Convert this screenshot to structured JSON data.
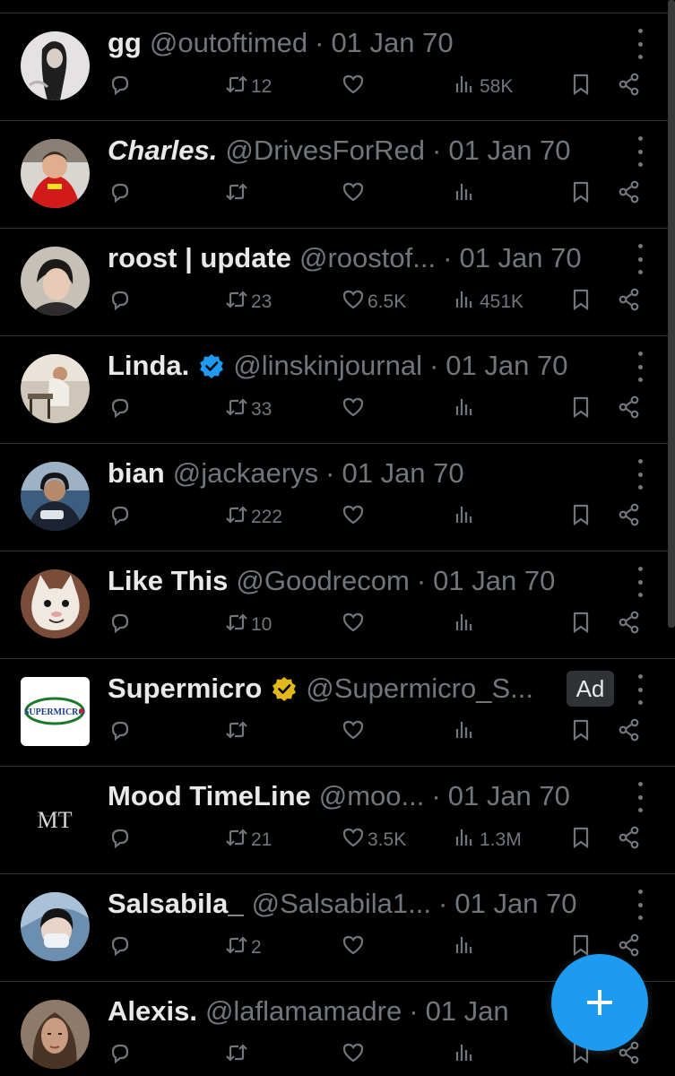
{
  "tweets": [
    {
      "name": "gg",
      "handle": "@outoftimed",
      "date": "01 Jan 70",
      "retweets": "12",
      "likes": "",
      "views": "58K",
      "verified": false,
      "ad": false,
      "italic": false
    },
    {
      "name": "Charles.",
      "handle": "@DrivesForRed",
      "date": "01 Jan 70",
      "retweets": "",
      "likes": "",
      "views": "",
      "verified": false,
      "ad": false,
      "italic": true
    },
    {
      "name": "roost | update",
      "handle": "@roostof...",
      "date": "01 Jan 70",
      "retweets": "23",
      "likes": "6.5K",
      "views": "451K",
      "verified": false,
      "ad": false,
      "italic": false
    },
    {
      "name": "Linda.",
      "handle": "@linskinjournal",
      "date": "01 Jan 70",
      "retweets": "33",
      "likes": "",
      "views": "",
      "verified": "blue",
      "ad": false,
      "italic": false
    },
    {
      "name": "bian",
      "handle": "@jackaerys",
      "date": "01 Jan 70",
      "retweets": "222",
      "likes": "",
      "views": "",
      "verified": false,
      "ad": false,
      "italic": false
    },
    {
      "name": "Like This",
      "handle": "@Goodrecom",
      "date": "01 Jan 70",
      "retweets": "10",
      "likes": "",
      "views": "",
      "verified": false,
      "ad": false,
      "italic": false
    },
    {
      "name": "Supermicro",
      "handle": "@Supermicro_S...",
      "date": "",
      "retweets": "",
      "likes": "",
      "views": "",
      "verified": "gold",
      "ad": true,
      "italic": false
    },
    {
      "name": "Mood TimeLine",
      "handle": "@moo...",
      "date": "01 Jan 70",
      "retweets": "21",
      "likes": "3.5K",
      "views": "1.3M",
      "verified": false,
      "ad": false,
      "italic": false
    },
    {
      "name": "Salsabila_",
      "handle": "@Salsabila1...",
      "date": "01 Jan 70",
      "retweets": "2",
      "likes": "",
      "views": "",
      "verified": false,
      "ad": false,
      "italic": false
    },
    {
      "name": "Alexis.",
      "handle": "@laflamamadre",
      "date": "01 Jan",
      "retweets": "",
      "likes": "",
      "views": "",
      "verified": false,
      "ad": false,
      "italic": false
    }
  ],
  "ad_label": "Ad",
  "supermicro_logo_text": "SUPERMICRO",
  "mood_logo_text": "MT",
  "colors": {
    "background": "#000000",
    "text_primary": "#e7e9ea",
    "text_secondary": "#71767b",
    "divider": "#2f3336",
    "accent": "#1d9bf0",
    "verified_gold": "#e2b719"
  },
  "icons": {
    "reply": "reply-icon",
    "retweet": "retweet-icon",
    "like": "heart-icon",
    "views": "views-icon",
    "bookmark": "bookmark-icon",
    "share": "share-icon",
    "more": "more-vertical-icon",
    "compose": "plus-icon"
  }
}
